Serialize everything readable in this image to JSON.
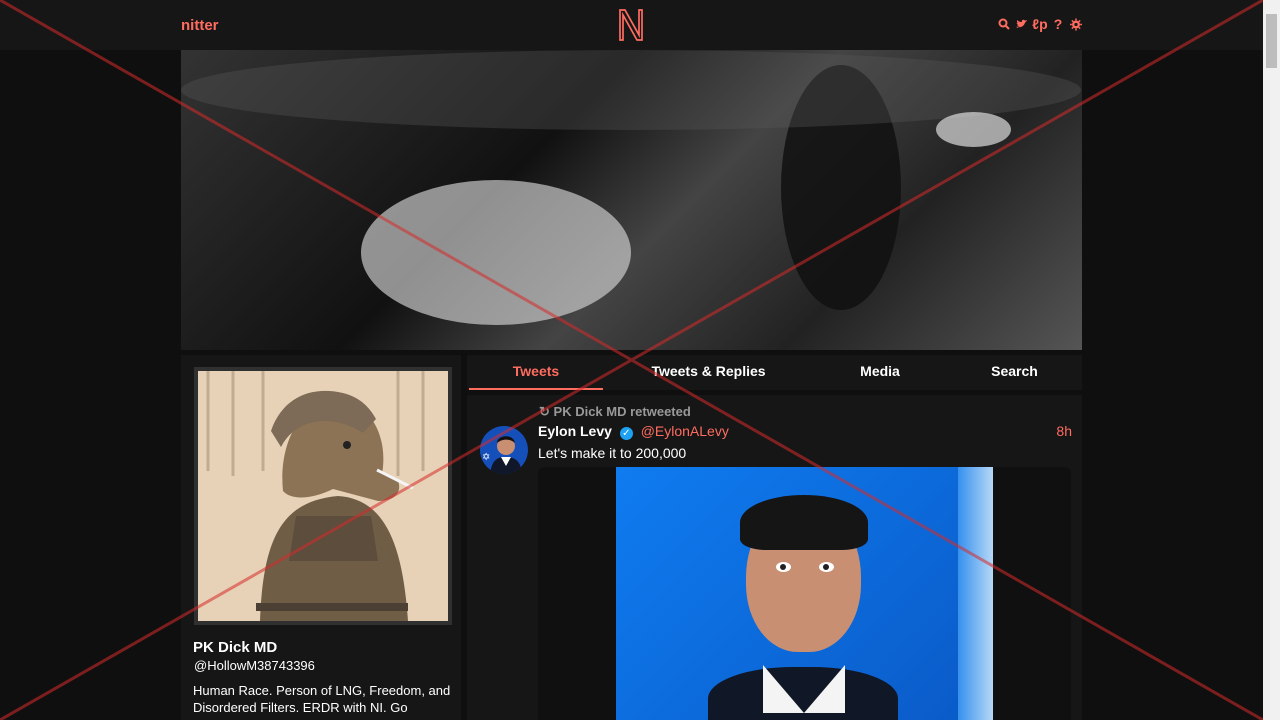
{
  "navbar": {
    "brand": "nitter",
    "logo_letter": "N",
    "icons": [
      "search-icon",
      "twitter-icon",
      "lp-icon",
      "help-icon",
      "gear-icon"
    ]
  },
  "profile": {
    "fullname": "PK Dick MD",
    "username": "@HollowM38743396",
    "bio": "Human Race. Person of LNG, Freedom, and Disordered Filters. ERDR with NI. Go"
  },
  "tabs": [
    "Tweets",
    "Tweets & Replies",
    "Media",
    "Search"
  ],
  "tweet": {
    "retweet_label": "PK Dick MD retweeted",
    "name": "Eylon Levy",
    "handle": "@EylonALevy",
    "time": "8h",
    "text": "Let's make it to 200,000"
  },
  "colors": {
    "accent": "#ff6c60",
    "background": "#0f0f0f",
    "panel": "#161616",
    "verified": "#1da1f2"
  }
}
